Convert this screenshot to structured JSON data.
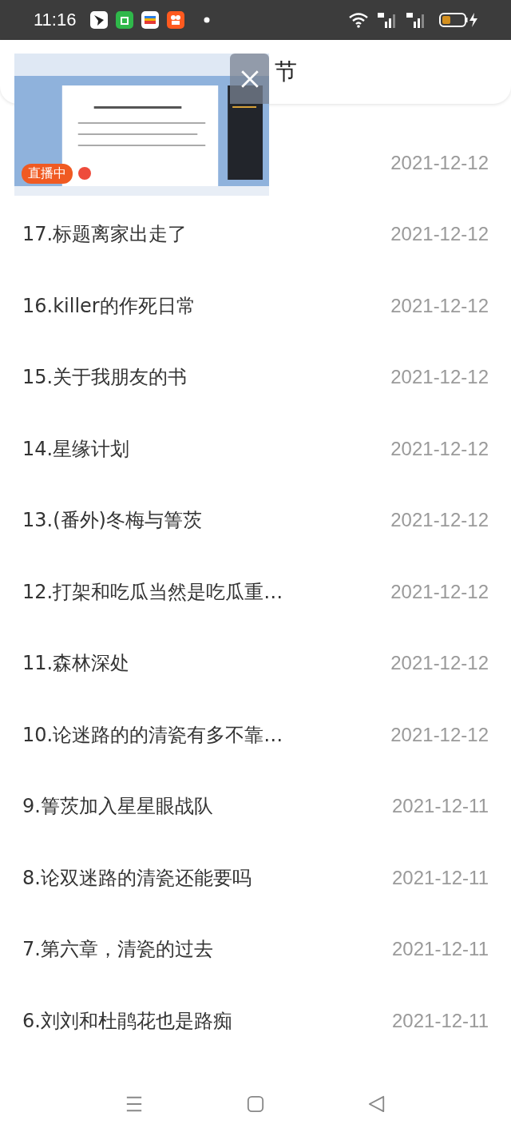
{
  "status_bar": {
    "time": "11:16"
  },
  "header": {
    "title": "节"
  },
  "floating_video": {
    "badge": "直播中"
  },
  "chapters": [
    {
      "date": "2021-12-12"
    },
    {
      "title": "17.标题离家出走了",
      "date": "2021-12-12"
    },
    {
      "title": "16.killer的作死日常",
      "date": "2021-12-12"
    },
    {
      "title": "15.关于我朋友的书",
      "date": "2021-12-12"
    },
    {
      "title": "14.星缘计划",
      "date": "2021-12-12"
    },
    {
      "title": "13.(番外)冬梅与箐茨",
      "date": "2021-12-12"
    },
    {
      "title": "12.打架和吃瓜当然是吃瓜重…",
      "date": "2021-12-12"
    },
    {
      "title": "11.森林深处",
      "date": "2021-12-12"
    },
    {
      "title": "10.论迷路的的清瓷有多不靠…",
      "date": "2021-12-12"
    },
    {
      "title": "9.箐茨加入星星眼战队",
      "date": "2021-12-11"
    },
    {
      "title": "8.论双迷路的清瓷还能要吗",
      "date": "2021-12-11"
    },
    {
      "title": "7.第六章，清瓷的过去",
      "date": "2021-12-11"
    },
    {
      "title": "6.刘刘和杜鹃花也是路痴",
      "date": "2021-12-11"
    }
  ]
}
